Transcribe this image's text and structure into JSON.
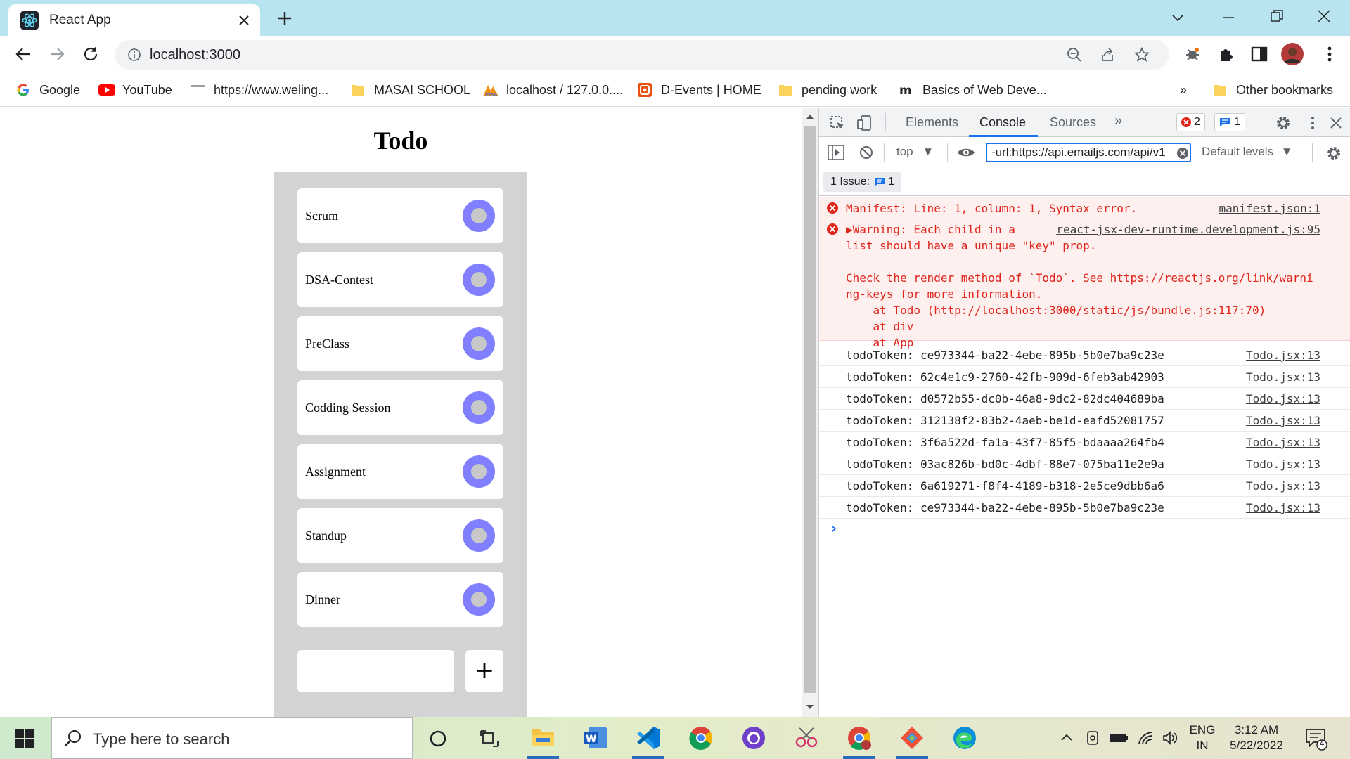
{
  "browser": {
    "tab_title": "React App",
    "url": "localhost:3000"
  },
  "bookmarks": [
    {
      "label": "Google",
      "icon": "google-icon"
    },
    {
      "label": "YouTube",
      "icon": "youtube-icon"
    },
    {
      "label": "https://www.weling...",
      "icon": "site-icon"
    },
    {
      "label": "MASAI SCHOOL",
      "icon": "folder-icon"
    },
    {
      "label": "localhost / 127.0.0....",
      "icon": "phpmyadmin-icon"
    },
    {
      "label": "D-Events | HOME",
      "icon": "devents-icon"
    },
    {
      "label": "pending work",
      "icon": "folder-icon"
    },
    {
      "label": "Basics of Web Deve...",
      "icon": "m-icon"
    }
  ],
  "bookmarks_overflow": "»",
  "other_bookmarks": "Other bookmarks",
  "todo": {
    "title": "Todo",
    "items": [
      "Scrum",
      "DSA-Contest",
      "PreClass",
      "Codding Session",
      "Assignment",
      "Standup",
      "Dinner"
    ],
    "input_value": "",
    "add_label": "+"
  },
  "devtools": {
    "tabs": [
      "Elements",
      "Console",
      "Sources"
    ],
    "active_tab": "Console",
    "more_tabs": "»",
    "error_count": "2",
    "message_count": "1",
    "context": "top",
    "filter": "-url:https://api.emailjs.com/api/v1",
    "levels": "Default levels",
    "issues_label": "1 Issue:",
    "issues_count": "1",
    "errors": [
      {
        "lines": [
          "Manifest: Line: 1, column: 1, Syntax error."
        ],
        "source": "manifest.json:1"
      },
      {
        "lines": [
          "▶Warning: Each child in a",
          "list should have a unique \"key\" prop.",
          "",
          "Check the render method of `Todo`. See https://reactjs.org/link/warni",
          "ng-keys for more information.",
          "    at Todo (http://localhost:3000/static/js/bundle.js:117:70)",
          "    at div",
          "    at App"
        ],
        "source": "react-jsx-dev-runtime.development.js:95"
      }
    ],
    "logs": [
      {
        "text": "todoToken: ce973344-ba22-4ebe-895b-5b0e7ba9c23e",
        "source": "Todo.jsx:13"
      },
      {
        "text": "todoToken: 62c4e1c9-2760-42fb-909d-6feb3ab42903",
        "source": "Todo.jsx:13"
      },
      {
        "text": "todoToken: d0572b55-dc0b-46a8-9dc2-82dc404689ba",
        "source": "Todo.jsx:13"
      },
      {
        "text": "todoToken: 312138f2-83b2-4aeb-be1d-eafd52081757",
        "source": "Todo.jsx:13"
      },
      {
        "text": "todoToken: 3f6a522d-fa1a-43f7-85f5-bdaaaa264fb4",
        "source": "Todo.jsx:13"
      },
      {
        "text": "todoToken: 03ac826b-bd0c-4dbf-88e7-075ba11e2e9a",
        "source": "Todo.jsx:13"
      },
      {
        "text": "todoToken: 6a619271-f8f4-4189-b318-2e5ce9dbb6a6",
        "source": "Todo.jsx:13"
      },
      {
        "text": "todoToken: ce973344-ba22-4ebe-895b-5b0e7ba9c23e",
        "source": "Todo.jsx:13"
      }
    ],
    "prompt": "›"
  },
  "taskbar": {
    "search_placeholder": "Type here to search",
    "lang_top": "ENG",
    "lang_bottom": "IN",
    "time": "3:12 AM",
    "date": "5/22/2022",
    "notification_count": "4"
  },
  "colors": {
    "tab_strip": "#b8e4f0",
    "toggle": "#7f7fff",
    "panel": "#d3d3d3",
    "error_text": "#e0241a",
    "error_bg": "#fff0f0",
    "accent": "#1a73e8"
  }
}
